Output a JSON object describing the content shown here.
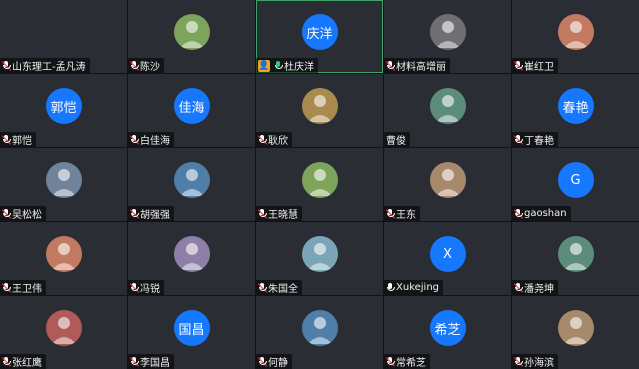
{
  "colors": {
    "accent": "#1677ff",
    "tile_bg": "#2a2d33",
    "active_border": "#3fa36a"
  },
  "navigation": {
    "prev_icon": "triangle-left",
    "next_icon": "triangle-right"
  },
  "tiles": [
    {
      "name": "山东理工-孟凡涛",
      "avatar_type": "none",
      "avatar_text": "",
      "mic": "muted"
    },
    {
      "name": "陈沙",
      "avatar_type": "photo",
      "avatar_text": "",
      "mic": "muted"
    },
    {
      "name": "杜庆洋",
      "avatar_type": "text",
      "avatar_text": "庆洋",
      "mic": "speaking",
      "active": true,
      "host_badge": true
    },
    {
      "name": "材料高增丽",
      "avatar_type": "photo",
      "avatar_text": "",
      "mic": "muted"
    },
    {
      "name": "崔红卫",
      "avatar_type": "photo",
      "avatar_text": "",
      "mic": "muted"
    },
    {
      "name": "郭恺",
      "avatar_type": "text",
      "avatar_text": "郭恺",
      "mic": "muted"
    },
    {
      "name": "白佳海",
      "avatar_type": "text",
      "avatar_text": "佳海",
      "mic": "muted"
    },
    {
      "name": "耿欣",
      "avatar_type": "photo",
      "avatar_text": "",
      "mic": "muted"
    },
    {
      "name": "曹俊",
      "avatar_type": "photo",
      "avatar_text": "",
      "mic": "none"
    },
    {
      "name": "丁春艳",
      "avatar_type": "text",
      "avatar_text": "春艳",
      "mic": "muted"
    },
    {
      "name": "吴松松",
      "avatar_type": "photo",
      "avatar_text": "",
      "mic": "muted"
    },
    {
      "name": "胡强强",
      "avatar_type": "photo",
      "avatar_text": "",
      "mic": "muted"
    },
    {
      "name": "王晓慧",
      "avatar_type": "photo",
      "avatar_text": "",
      "mic": "muted"
    },
    {
      "name": "王东",
      "avatar_type": "photo",
      "avatar_text": "",
      "mic": "muted"
    },
    {
      "name": "gaoshan",
      "avatar_type": "text",
      "avatar_text": "G",
      "mic": "muted"
    },
    {
      "name": "王卫伟",
      "avatar_type": "photo",
      "avatar_text": "",
      "mic": "muted"
    },
    {
      "name": "冯锐",
      "avatar_type": "photo",
      "avatar_text": "",
      "mic": "muted"
    },
    {
      "name": "朱国全",
      "avatar_type": "photo",
      "avatar_text": "",
      "mic": "muted"
    },
    {
      "name": "Xukejing",
      "avatar_type": "text",
      "avatar_text": "X",
      "mic": "unmuted"
    },
    {
      "name": "潘尧坤",
      "avatar_type": "photo",
      "avatar_text": "",
      "mic": "muted"
    },
    {
      "name": "张红鹰",
      "avatar_type": "photo",
      "avatar_text": "",
      "mic": "muted"
    },
    {
      "name": "李国昌",
      "avatar_type": "text",
      "avatar_text": "国昌",
      "mic": "muted"
    },
    {
      "name": "何静",
      "avatar_type": "photo",
      "avatar_text": "",
      "mic": "muted"
    },
    {
      "name": "常希芝",
      "avatar_type": "text",
      "avatar_text": "希芝",
      "mic": "muted"
    },
    {
      "name": "孙海滨",
      "avatar_type": "photo",
      "avatar_text": "",
      "mic": "muted"
    }
  ]
}
